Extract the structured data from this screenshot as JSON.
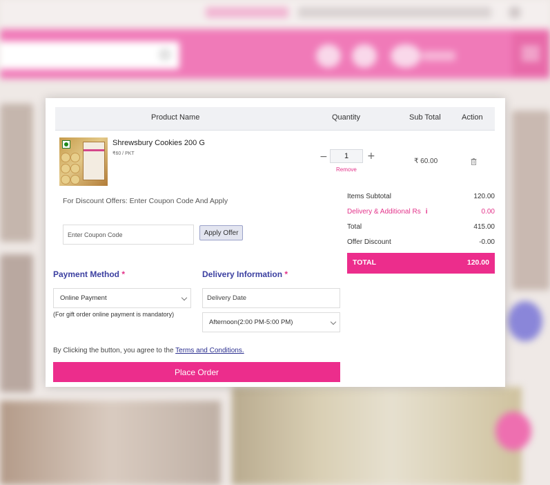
{
  "table": {
    "headers": {
      "product_name": "Product Name",
      "quantity": "Quantity",
      "sub_total": "Sub Total",
      "action": "Action"
    }
  },
  "item": {
    "name": "Shrewsbury Cookies 200 G",
    "unit_price": "₹60 / PKT",
    "quantity": "1",
    "remove_label": "Remove",
    "sub_total": "₹ 60.00",
    "veg_indicator": "veg-dot-icon",
    "delete_icon": "trash-icon"
  },
  "coupon": {
    "label": "For Discount Offers: Enter Coupon Code And Apply",
    "placeholder": "Enter Coupon Code",
    "apply_label": "Apply Offer"
  },
  "summary": {
    "items_subtotal_label": "Items Subtotal",
    "items_subtotal_value": "120.00",
    "delivery_label": "Delivery & Additional Rs",
    "delivery_value": "0.00",
    "total_label": "Total",
    "total_value": "415.00",
    "offer_discount_label": "Offer Discount",
    "offer_discount_value": "-0.00",
    "grand_total_label": "TOTAL",
    "grand_total_value": "120.00"
  },
  "payment": {
    "title": "Payment Method",
    "required_mark": "*",
    "selected": "Online Payment",
    "note": "(For gift order online payment is mandatory)"
  },
  "delivery": {
    "title": "Delivery Information",
    "required_mark": "*",
    "date_placeholder": "Delivery Date",
    "time_slot": "Afternoon(2:00 PM-5:00 PM)"
  },
  "agreement": {
    "prefix": "By Clicking the button, you agree to the ",
    "link": "Terms and Conditions."
  },
  "place_order_label": "Place Order",
  "colors": {
    "accent_pink": "#ec2d8c",
    "heading_blue": "#3b3fa0",
    "header_pink": "#f07ab8"
  }
}
